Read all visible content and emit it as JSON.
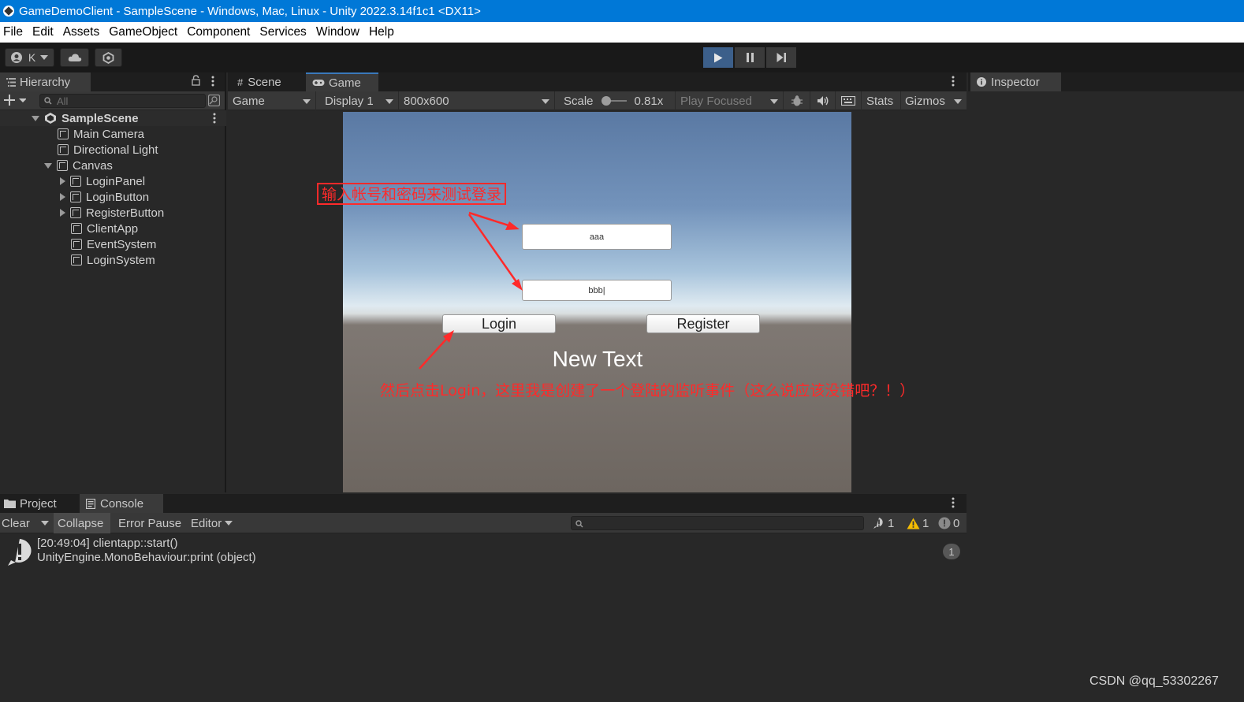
{
  "window": {
    "title": "GameDemoClient - SampleScene - Windows, Mac, Linux - Unity 2022.3.14f1c1 <DX11>"
  },
  "menu": [
    "File",
    "Edit",
    "Assets",
    "GameObject",
    "Component",
    "Services",
    "Window",
    "Help"
  ],
  "toolbar": {
    "account_initial": "K"
  },
  "hierarchy": {
    "tab_label": "Hierarchy",
    "search_placeholder": "All",
    "scene_name": "SampleScene",
    "items": [
      "Main Camera",
      "Directional Light",
      "Canvas",
      "LoginPanel",
      "LoginButton",
      "RegisterButton",
      "ClientApp",
      "EventSystem",
      "LoginSystem"
    ]
  },
  "game_panel": {
    "tabs": [
      "Scene",
      "Game"
    ],
    "view_mode": "Game",
    "display": "Display 1",
    "resolution": "800x600",
    "scale_label": "Scale",
    "scale_value": "0.81x",
    "play_mode": "Play Focused",
    "stats_label": "Stats",
    "gizmos_label": "Gizmos"
  },
  "game_view": {
    "username_value": "aaa",
    "password_value": "bbb|",
    "login_button": "Login",
    "register_button": "Register",
    "status_text": "New Text",
    "annotation_top": "输入帐号和密码来测试登录",
    "annotation_bottom": "然后点击Login，这里我是创建了一个登陆的监听事件（这么说应该没错吧？！）",
    "annotation_color": "#ff2a2a"
  },
  "inspector": {
    "tab_label": "Inspector"
  },
  "console": {
    "tabs": [
      "Project",
      "Console"
    ],
    "clear_label": "Clear",
    "collapse_label": "Collapse",
    "error_pause_label": "Error Pause",
    "editor_label": "Editor",
    "info_count": "1",
    "warning_count": "1",
    "error_count": "0",
    "entries": [
      {
        "line1": "[20:49:04] clientapp::start()",
        "line2": "UnityEngine.MonoBehaviour:print (object)",
        "count": "1"
      }
    ]
  },
  "watermark": "CSDN @qq_53302267",
  "colors": {
    "title_bar": "#0078d7",
    "play_active": "#3c5f8a",
    "panel_bg": "#282828",
    "header_bg": "#383838"
  }
}
